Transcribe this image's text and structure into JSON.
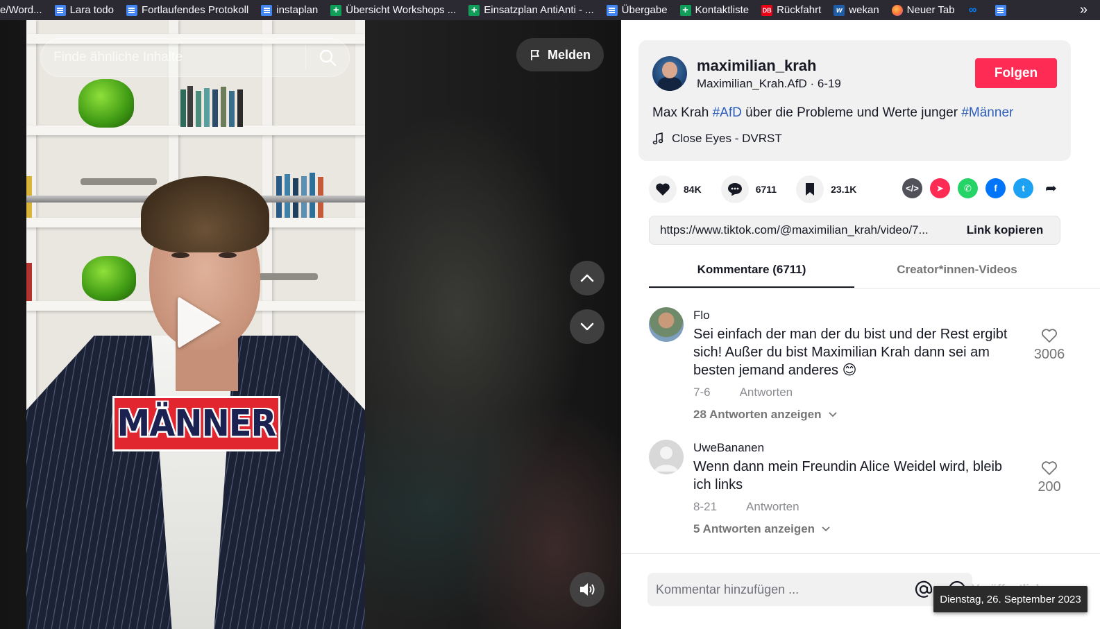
{
  "bookmarks": [
    {
      "label": "e/Word...",
      "icon": "none"
    },
    {
      "label": "Lara todo",
      "icon": "docs-icon"
    },
    {
      "label": "Fortlaufendes Protokoll",
      "icon": "docs-icon"
    },
    {
      "label": "instaplan",
      "icon": "docs-icon"
    },
    {
      "label": "Übersicht Workshops ...",
      "icon": "sheets-icon"
    },
    {
      "label": "Einsatzplan AntiAnti - ...",
      "icon": "sheets-icon"
    },
    {
      "label": "Übergabe",
      "icon": "docs-icon"
    },
    {
      "label": "Kontaktliste",
      "icon": "sheets-icon"
    },
    {
      "label": "Rückfahrt",
      "icon": "db-icon"
    },
    {
      "label": "wekan",
      "icon": "wekan-icon"
    },
    {
      "label": "Neuer Tab",
      "icon": "firefox-icon"
    },
    {
      "label": "",
      "icon": "meta-icon"
    },
    {
      "label": "",
      "icon": "docs-icon"
    }
  ],
  "video": {
    "search_placeholder": "Finde ähnliche Inhalte",
    "report_label": "Melden",
    "overlay_text": "MÄNNER"
  },
  "author": {
    "username": "maximilian_krah",
    "subline": "Maximilian_Krah.AfD · 6-19",
    "follow_label": "Folgen",
    "desc_prefix": "Max Krah ",
    "hashtag1": "#AfD",
    "desc_middle": " über die Probleme und Werte junger ",
    "hashtag2": "#Männer",
    "music": "Close Eyes - DVRST"
  },
  "stats": {
    "likes": "84K",
    "comments": "6711",
    "saves": "23.1K"
  },
  "link": {
    "url": "https://www.tiktok.com/@maximilian_krah/video/7...",
    "copy_label": "Link kopieren"
  },
  "tabs": {
    "comments": "Kommentare (6711)",
    "creator_videos": "Creator*innen-Videos"
  },
  "comments": [
    {
      "name": "Flo",
      "text": "Sei einfach der man der du bist und der Rest ergibt sich! Außer du bist Maximilian Krah dann sei am besten jemand anderes 😊",
      "date": "7-6",
      "reply_label": "Antworten",
      "replies_label": "28 Antworten anzeigen",
      "likes": "3006"
    },
    {
      "name": "UweBananen",
      "text": "Wenn dann mein Freundin Alice Weidel wird, bleib ich links",
      "date": "8-21",
      "reply_label": "Antworten",
      "replies_label": "5 Antworten anzeigen",
      "likes": "200"
    }
  ],
  "composer": {
    "placeholder": "Kommentar hinzufügen ...",
    "publish_label": "Veröffentlichen"
  },
  "tooltip": "Dienstag, 26. September 2023",
  "colors": {
    "accent": "#fe2c55",
    "hashtag": "#2b5db9",
    "bookmark_bar": "#2b2a33"
  }
}
